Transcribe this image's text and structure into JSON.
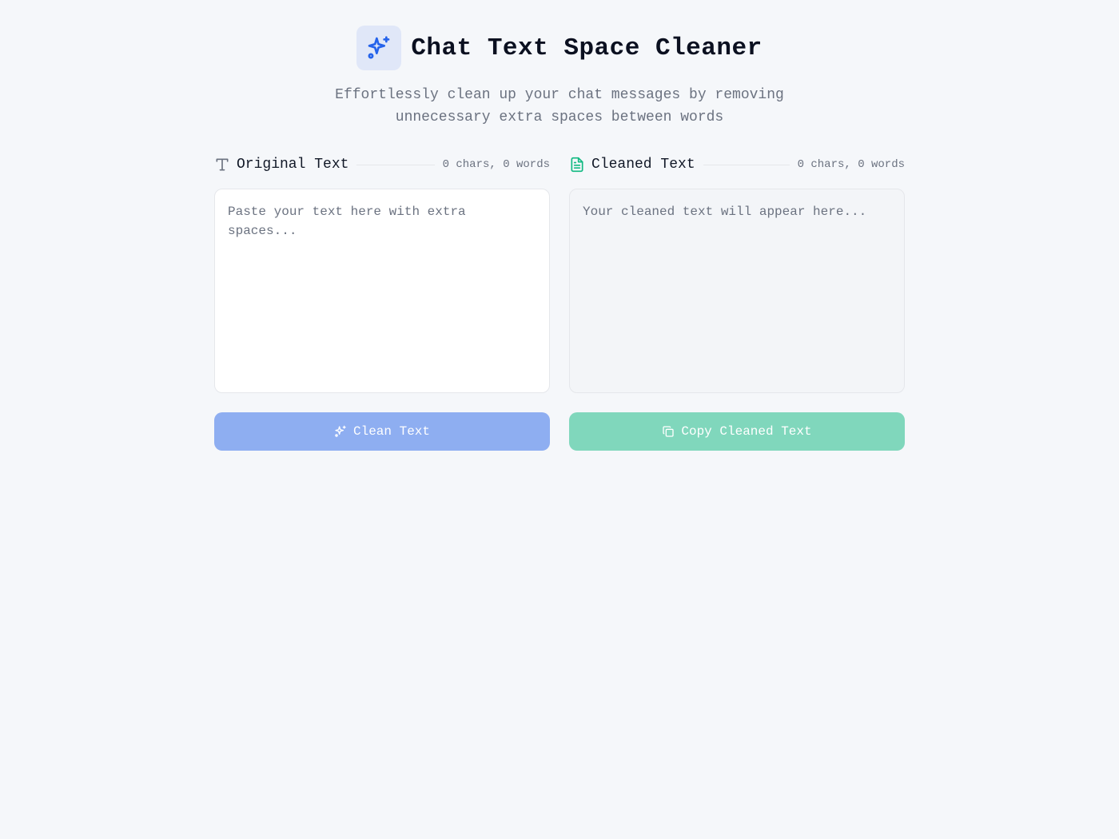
{
  "header": {
    "title": "Chat Text Space Cleaner",
    "subtitle": "Effortlessly clean up your chat messages by removing unnecessary extra spaces between words",
    "logo_icon": "sparkles-icon"
  },
  "input_panel": {
    "label": "Original Text",
    "icon": "text-type-icon",
    "counter": "0 chars, 0 words",
    "placeholder": "Paste your text here with extra spaces...",
    "value": ""
  },
  "output_panel": {
    "label": "Cleaned Text",
    "icon": "file-text-icon",
    "counter": "0 chars, 0 words",
    "placeholder": "Your cleaned text will appear here...",
    "value": ""
  },
  "actions": {
    "clean_label": "Clean Text",
    "clean_icon": "sparkles-icon",
    "copy_label": "Copy Cleaned Text",
    "copy_icon": "copy-icon"
  },
  "colors": {
    "accent_blue": "#2563eb",
    "accent_green": "#10b981",
    "clean_button": "#8eaef1",
    "copy_button": "#80d7bc",
    "background": "#f5f7fa"
  }
}
